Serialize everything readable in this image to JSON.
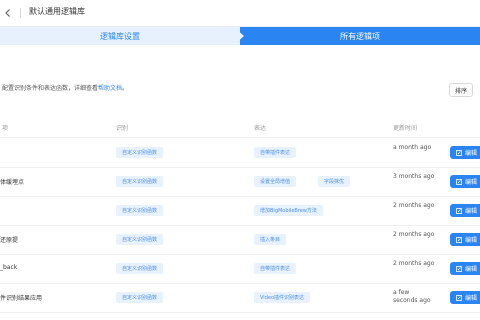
{
  "header": {
    "title": "默认通用逻辑库"
  },
  "steps": [
    {
      "label": "逻辑库设置"
    },
    {
      "label": "所有逻辑项"
    }
  ],
  "intro": {
    "text": "配置识别条件和表达函数，详细查看",
    "link": "帮助文档",
    "suffix": "。"
  },
  "toolbar": {
    "sort_label": "排序"
  },
  "table": {
    "columns": [
      "项",
      "识别",
      "表达",
      "更新时间"
    ],
    "rows": [
      {
        "name": "",
        "recognition": "自定义识别函数",
        "expressions": [
          "自带插件表达"
        ],
        "updated": "a month ago",
        "action": "编辑"
      },
      {
        "name": "体缓埋点",
        "recognition": "自定义识别函数",
        "expressions": [
          "设置全局增值",
          "字段抹优"
        ],
        "updated": "3 months ago",
        "action": "编辑"
      },
      {
        "name": "",
        "recognition": "自定义识别函数",
        "expressions": [
          "增加BigMobileBrew方法"
        ],
        "updated": "2 months ago",
        "action": "编辑"
      },
      {
        "name": "还原提",
        "recognition": "自定义识别函数",
        "expressions": [
          "插入条目"
        ],
        "updated": "2 months ago",
        "action": "编辑"
      },
      {
        "name": "_back",
        "recognition": "自定义识别函数",
        "expressions": [
          "自带插件表达"
        ],
        "updated": "2 months ago",
        "action": "编辑"
      },
      {
        "name": "件识别结果应用",
        "recognition": "自定义识别函数",
        "expressions": [
          "Video插件识别表达"
        ],
        "updated": "a few seconds ago",
        "action": "编辑"
      }
    ]
  },
  "colors": {
    "accent": "#2a84f1",
    "step_inactive_bg": "#e6f1fd",
    "tag_bg": "#e8f2fe"
  },
  "icons": {
    "back": "chevron-left-icon",
    "edit": "edit-icon"
  }
}
